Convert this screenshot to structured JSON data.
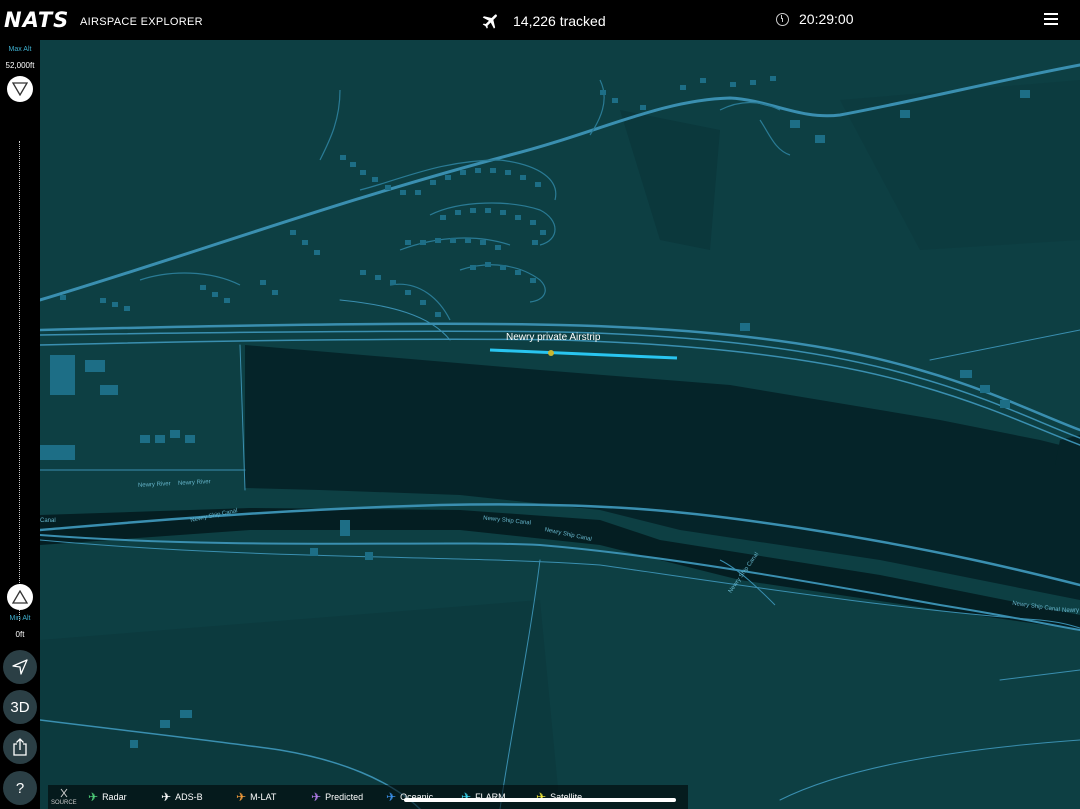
{
  "header": {
    "logo": "NATS",
    "subtitle": "AIRSPACE EXPLORER",
    "tracked_text": "14,226 tracked",
    "time": "20:29:00",
    "plane_icon": "plane-icon",
    "clock_icon": "clock-icon",
    "menu_icon": "hamburger-menu-icon"
  },
  "altitude": {
    "max_label": "Max Alt",
    "max_value": "52,000ft",
    "min_label": "Min Alt",
    "min_value": "0ft"
  },
  "tools": {
    "locate_icon": "navigation-arrow-icon",
    "view_3d": "3D",
    "share_icon": "share-icon",
    "help": "?"
  },
  "map": {
    "airstrip_label": "Newry private Airstrip",
    "labels": {
      "river_1": "Newry River",
      "river_2": "Newry River",
      "canal_1": "Newry Ship Canal",
      "canal_2": "Newry Ship Canal",
      "canal_3": "Newry Ship Canal",
      "canal_4": "Newry Ship Canal",
      "canal_5": "Newry Ship Canal",
      "canal_6": "Newry",
      "canal_7": "Canal"
    },
    "colors": {
      "land": "#0d3f43",
      "water": "#052429",
      "roads": "#3a8fb0",
      "runway": "#29c5f0",
      "buildings": "#1d6e86"
    }
  },
  "legend": {
    "source_label": "SOURCE",
    "items": [
      {
        "label": "Radar",
        "color": "#4fd07a"
      },
      {
        "label": "ADS-B",
        "color": "#ffffff"
      },
      {
        "label": "M-LAT",
        "color": "#f09a3a"
      },
      {
        "label": "Predicted",
        "color": "#b07ce8"
      },
      {
        "label": "Oceanic",
        "color": "#3a8fe8"
      },
      {
        "label": "FLARM",
        "color": "#3ad0e8"
      },
      {
        "label": "Satellite",
        "color": "#e8e03a"
      }
    ]
  }
}
